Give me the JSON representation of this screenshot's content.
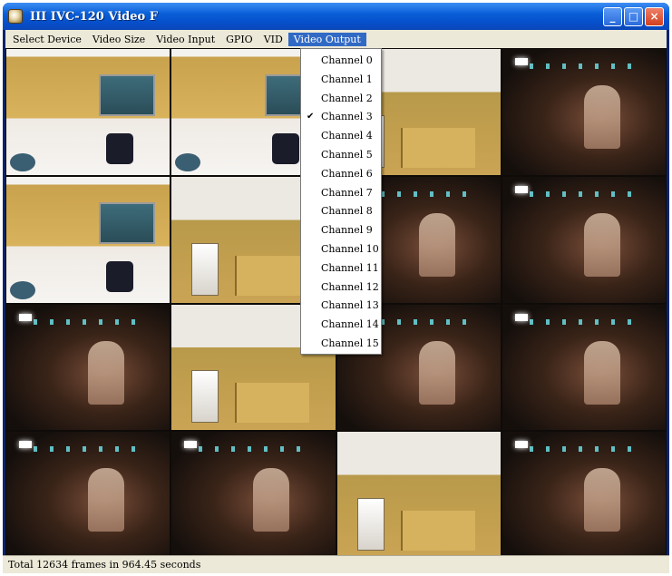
{
  "window": {
    "title": "III IVC-120 Video F",
    "controls": {
      "minimize": "_",
      "maximize": "□",
      "close": "×"
    }
  },
  "menubar": {
    "items": [
      {
        "label": "Select Device"
      },
      {
        "label": "Video Size"
      },
      {
        "label": "Video Input"
      },
      {
        "label": "GPIO"
      },
      {
        "label": "VID"
      },
      {
        "label": "Video Output",
        "active": true
      }
    ]
  },
  "video_output_menu": {
    "selected": "Channel 3",
    "items": [
      {
        "label": "Channel 0"
      },
      {
        "label": "Channel 1"
      },
      {
        "label": "Channel 2"
      },
      {
        "label": "Channel 3",
        "checked": true
      },
      {
        "label": "Channel 4"
      },
      {
        "label": "Channel 5"
      },
      {
        "label": "Channel 6"
      },
      {
        "label": "Channel 7"
      },
      {
        "label": "Channel 8"
      },
      {
        "label": "Channel 9"
      },
      {
        "label": "Channel 10"
      },
      {
        "label": "Channel 11"
      },
      {
        "label": "Channel 12"
      },
      {
        "label": "Channel 13"
      },
      {
        "label": "Channel 14"
      },
      {
        "label": "Channel 15"
      }
    ]
  },
  "video_grid": {
    "tiles": [
      "office",
      "office",
      "room",
      "crowd",
      "office",
      "room",
      "crowd",
      "crowd",
      "crowd",
      "room",
      "crowd",
      "crowd",
      "crowd",
      "crowd",
      "room",
      "crowd"
    ]
  },
  "status": {
    "text": "Total 12634 frames in 964.45 seconds"
  }
}
